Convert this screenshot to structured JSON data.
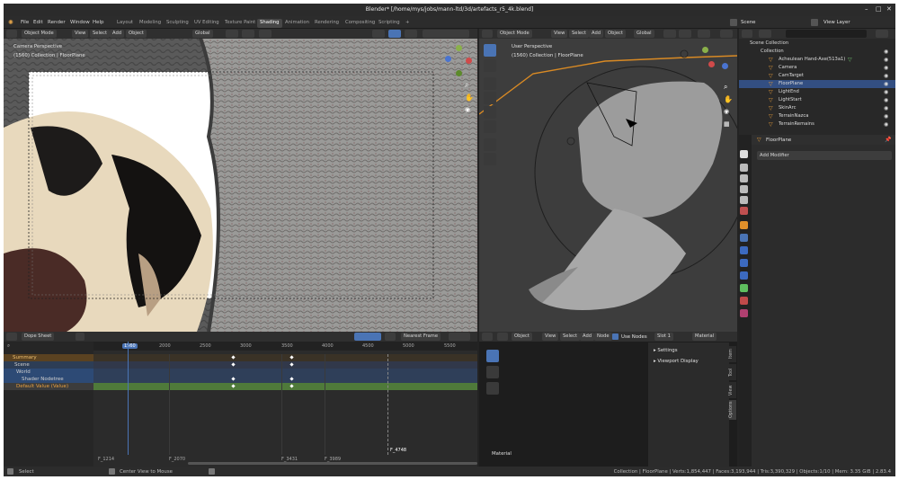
{
  "window": {
    "title": "Blender* [/home/mys/jobs/mann-ltd/3d/artefacts_r5_4k.blend]",
    "minimize": "–",
    "maximize": "□",
    "close": "✕"
  },
  "menu": {
    "items": [
      "File",
      "Edit",
      "Render",
      "Window",
      "Help"
    ]
  },
  "workspaces": [
    "Layout",
    "Modeling",
    "Sculpting",
    "UV Editing",
    "Texture Paint",
    "Shading",
    "Animation",
    "Rendering",
    "Compositing",
    "Scripting",
    "+"
  ],
  "scene": {
    "label": "Scene",
    "view_layer": "View Layer"
  },
  "camera_view": {
    "mode": "Object Mode",
    "menus": [
      "View",
      "Select",
      "Add",
      "Object"
    ],
    "orientation": "Global",
    "title": "Camera Perspective",
    "subtitle": "(1560) Collection | FloorPlane"
  },
  "user_view": {
    "mode": "Object Mode",
    "menus": [
      "View",
      "Select",
      "Add",
      "Object"
    ],
    "orientation": "Global",
    "title": "User Perspective",
    "subtitle": "(1560) Collection | FloorPlane"
  },
  "outliner": {
    "root": "Scene Collection",
    "collection": "Collection",
    "items": [
      {
        "name": "Acheulean Hand-Axe(513a1)",
        "selected": false
      },
      {
        "name": "Camera",
        "selected": false
      },
      {
        "name": "CamTarget",
        "selected": false
      },
      {
        "name": "FloorPlane",
        "selected": true
      },
      {
        "name": "LightEnd",
        "selected": false
      },
      {
        "name": "LightStart",
        "selected": false
      },
      {
        "name": "SkinArc",
        "selected": false
      },
      {
        "name": "TerrainNazca",
        "selected": false
      },
      {
        "name": "TerrainRemains",
        "selected": false
      }
    ]
  },
  "properties": {
    "object": "FloorPlane",
    "add_modifier": "Add Modifier"
  },
  "dopesheet": {
    "editor": "Dope Sheet",
    "snap": "Nearest Frame",
    "current_frame": "1560",
    "ruler": [
      "1560",
      "2000",
      "2500",
      "3000",
      "3500",
      "4000",
      "4500",
      "5000",
      "5500"
    ],
    "channels": [
      "Summary",
      "Scene",
      "World",
      "Shader Nodetree",
      "Default Value (Value)"
    ],
    "markers": [
      "F_1214",
      "F_2070",
      "F_3431",
      "F_3989",
      "F_4748"
    ]
  },
  "node_editor": {
    "menu_object": "Object",
    "menus": [
      "View",
      "Select",
      "Add",
      "Node"
    ],
    "use_nodes": "Use Nodes",
    "slot": "Slot 1",
    "material": "Material",
    "panel_items": [
      "Settings",
      "Viewport Display"
    ],
    "tabs": [
      "Item",
      "Tool",
      "View",
      "Options"
    ],
    "footer": "Material"
  },
  "statusbar": {
    "select": "Select",
    "center": "Center View to Mouse",
    "stats": "Collection | FloorPlane | Verts:1,854,447 | Faces:3,193,944 | Tris:3,390,329 | Objects:1/10 | Mem: 3.35 GiB | 2.83.4"
  },
  "colors": {
    "accent": "#4a74b5",
    "selection": "#334f82",
    "timeline_green": "#4f7a3a",
    "summary_orange": "#bf7a2a"
  }
}
